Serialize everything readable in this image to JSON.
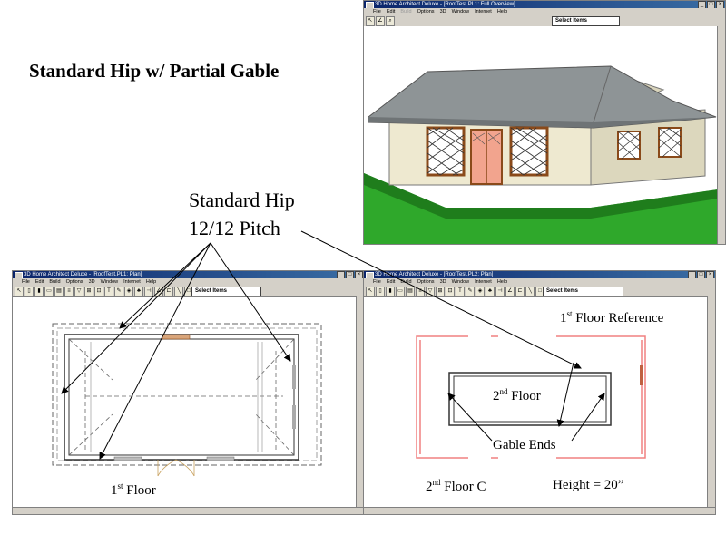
{
  "slide": {
    "title": "Standard Hip w/ Partial Gable",
    "callout_line1": "Standard Hip",
    "callout_line2": "12/12 Pitch"
  },
  "overview_window": {
    "title": "3D Home Architect Deluxe - [RoofTest.PL1: Full Overview]",
    "menus": [
      "File",
      "Edit",
      "Build",
      "Options",
      "3D",
      "Window",
      "Internet",
      "Help"
    ],
    "select_label": "Select Items"
  },
  "plan1_window": {
    "title": "3D Home Architect Deluxe - [RoofTest.PL1: Plan]",
    "menus": [
      "File",
      "Edit",
      "Build",
      "Options",
      "3D",
      "Window",
      "Internet",
      "Help"
    ],
    "select_label": "Select Items",
    "floor_label": "1st Floor",
    "floor_num": "1",
    "floor_sup": "st",
    "floor_word": " Floor"
  },
  "plan2_window": {
    "title": "3D Home Architect Deluxe - [RoofTest.PL2: Plan]",
    "menus": [
      "File",
      "Edit",
      "Build",
      "Options",
      "3D",
      "Window",
      "Internet",
      "Help"
    ],
    "select_label": "Select Items",
    "ref_num": "1",
    "ref_sup": "st",
    "ref_word": " Floor Reference",
    "second_num": "2",
    "second_sup": "nd",
    "second_word": " Floor",
    "gable_ends": "Gable Ends",
    "bottom_num": "2",
    "bottom_sup": "nd",
    "bottom_word": " Floor C",
    "height_text": "Height = 20”"
  },
  "colors": {
    "title_bar": "#0a246a",
    "chrome": "#d4d0c8",
    "roof": "#8e9496",
    "wall": "#eee9d0",
    "trim": "#8a4a1a",
    "door": "#f2a48e",
    "grass": "#2fa82b",
    "ref_lines": "#f08080"
  }
}
